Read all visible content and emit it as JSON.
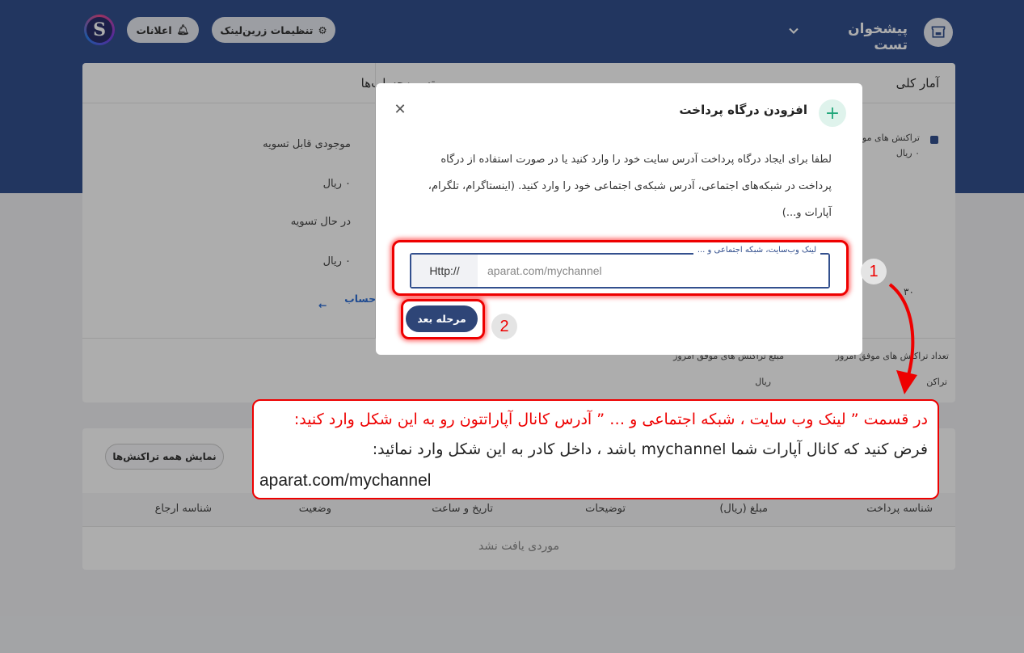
{
  "header": {
    "brand": "پیشخوان تست",
    "settings_label": "تنظیمات زرین‌لینک",
    "notifications_label": "اعلانات",
    "avatar_letter": "S"
  },
  "stats": {
    "tab_overview": "آمار کلی",
    "tab_settlement": "تسویه‌حساب‌ها",
    "legend_tx": "تراکنش های مو",
    "legend_amount": "٠ ریال",
    "axis_tick": "٣٠",
    "settle_available_label": "موجودی قابل تسویه",
    "settle_available_value": "٠ ریال",
    "settle_pending_label": "در حال تسویه",
    "settle_pending_value": "٠ ریال",
    "all_settlements_link": "همه تسویه حساب ها",
    "count_success_label": "تعداد تراکنش های موفق امروز",
    "count_success_bullet": "تراکن",
    "amount_success_label": "مبلغ تراکنش های موفق امروز",
    "amount_success_value": "ریال"
  },
  "transactions": {
    "show_all_button": "نمایش همه تراکنش‌ها",
    "columns": [
      "شناسه پرداخت",
      "مبلغ (ریال)",
      "توضیحات",
      "تاریخ و ساعت",
      "وضعیت",
      "شناسه ارجاع"
    ],
    "empty_text": "موردی یافت نشد"
  },
  "modal": {
    "title": "افزودن درگاه پرداخت",
    "description": "لطفا برای ایجاد درگاه پرداخت آدرس سایت خود را وارد کنید یا در صورت استفاده از درگاه پرداخت در شبکه‌های اجتماعی، آدرس شبکه‌ی اجتماعی خود را وارد کنید. (اینستاگرام، تلگرام، آپارات و...)",
    "field_label": "لینک وب‌سایت، شبکه اجتماعی و ...",
    "field_prefix": "Http://",
    "field_placeholder": "aparat.com/mychannel",
    "next_button": "مرحله بعد"
  },
  "annotations": {
    "step1": "1",
    "step2": "2",
    "callout_line1": "در قسمت ” لینک وب سایت ، شبکه اجتماعی و … ” آدرس کانال آپاراتتون رو به این شکل وارد کنید:",
    "callout_line2": "فرض کنید که کانال آپارات شما mychannel باشد ، داخل کادر به این شکل وارد نمائید:",
    "callout_line3": "aparat.com/mychannel",
    "highlight_color": "#ee0000"
  },
  "colors": {
    "primary": "#33508e",
    "accent_green": "#21a67a",
    "link_blue": "#2f6fd6"
  }
}
